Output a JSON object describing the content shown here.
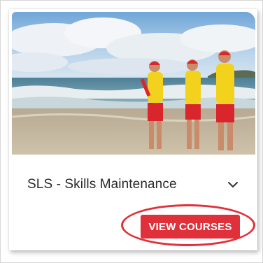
{
  "card": {
    "image_alt": "Lifeguards walking on beach",
    "title": "SLS - Skills Maintenance",
    "expand_icon": "chevron-down-icon",
    "button_label": "VIEW COURSES"
  },
  "colors": {
    "accent": "#e0313b",
    "title_text": "#2a2a2a",
    "uniform_yellow": "#f2d21c",
    "uniform_red": "#d9262c"
  }
}
